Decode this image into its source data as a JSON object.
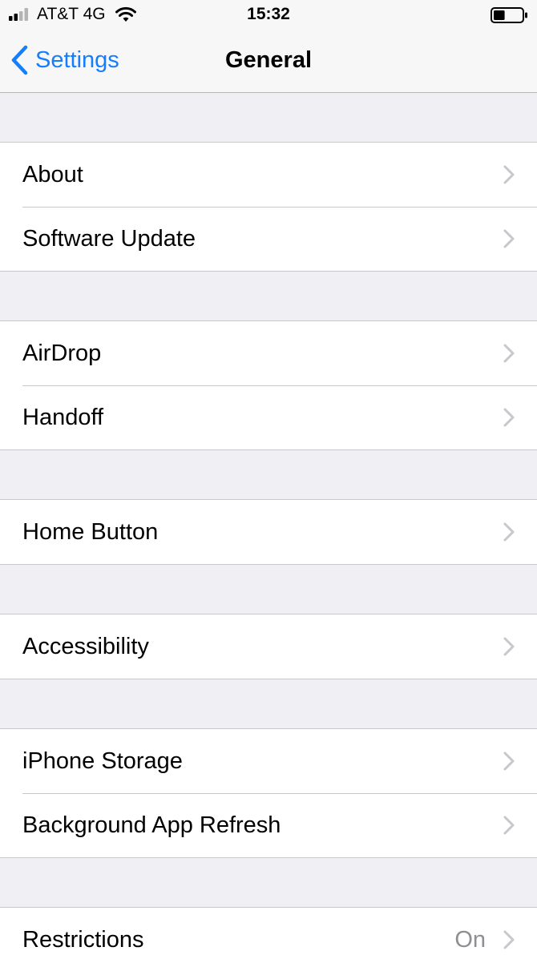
{
  "status_bar": {
    "carrier": "AT&T 4G",
    "time": "15:32",
    "signal_icon": "cellular-signal-icon",
    "wifi_icon": "wifi-icon",
    "battery_icon": "battery-icon",
    "battery_level": 0.4
  },
  "nav": {
    "back_label": "Settings",
    "title": "General",
    "accent_color": "#157efb"
  },
  "groups": [
    {
      "rows": [
        {
          "label": "About"
        },
        {
          "label": "Software Update"
        }
      ]
    },
    {
      "rows": [
        {
          "label": "AirDrop"
        },
        {
          "label": "Handoff"
        }
      ]
    },
    {
      "rows": [
        {
          "label": "Home Button"
        }
      ]
    },
    {
      "rows": [
        {
          "label": "Accessibility"
        }
      ]
    },
    {
      "rows": [
        {
          "label": "iPhone Storage"
        },
        {
          "label": "Background App Refresh"
        }
      ]
    },
    {
      "rows": [
        {
          "label": "Restrictions",
          "value": "On"
        }
      ]
    }
  ]
}
